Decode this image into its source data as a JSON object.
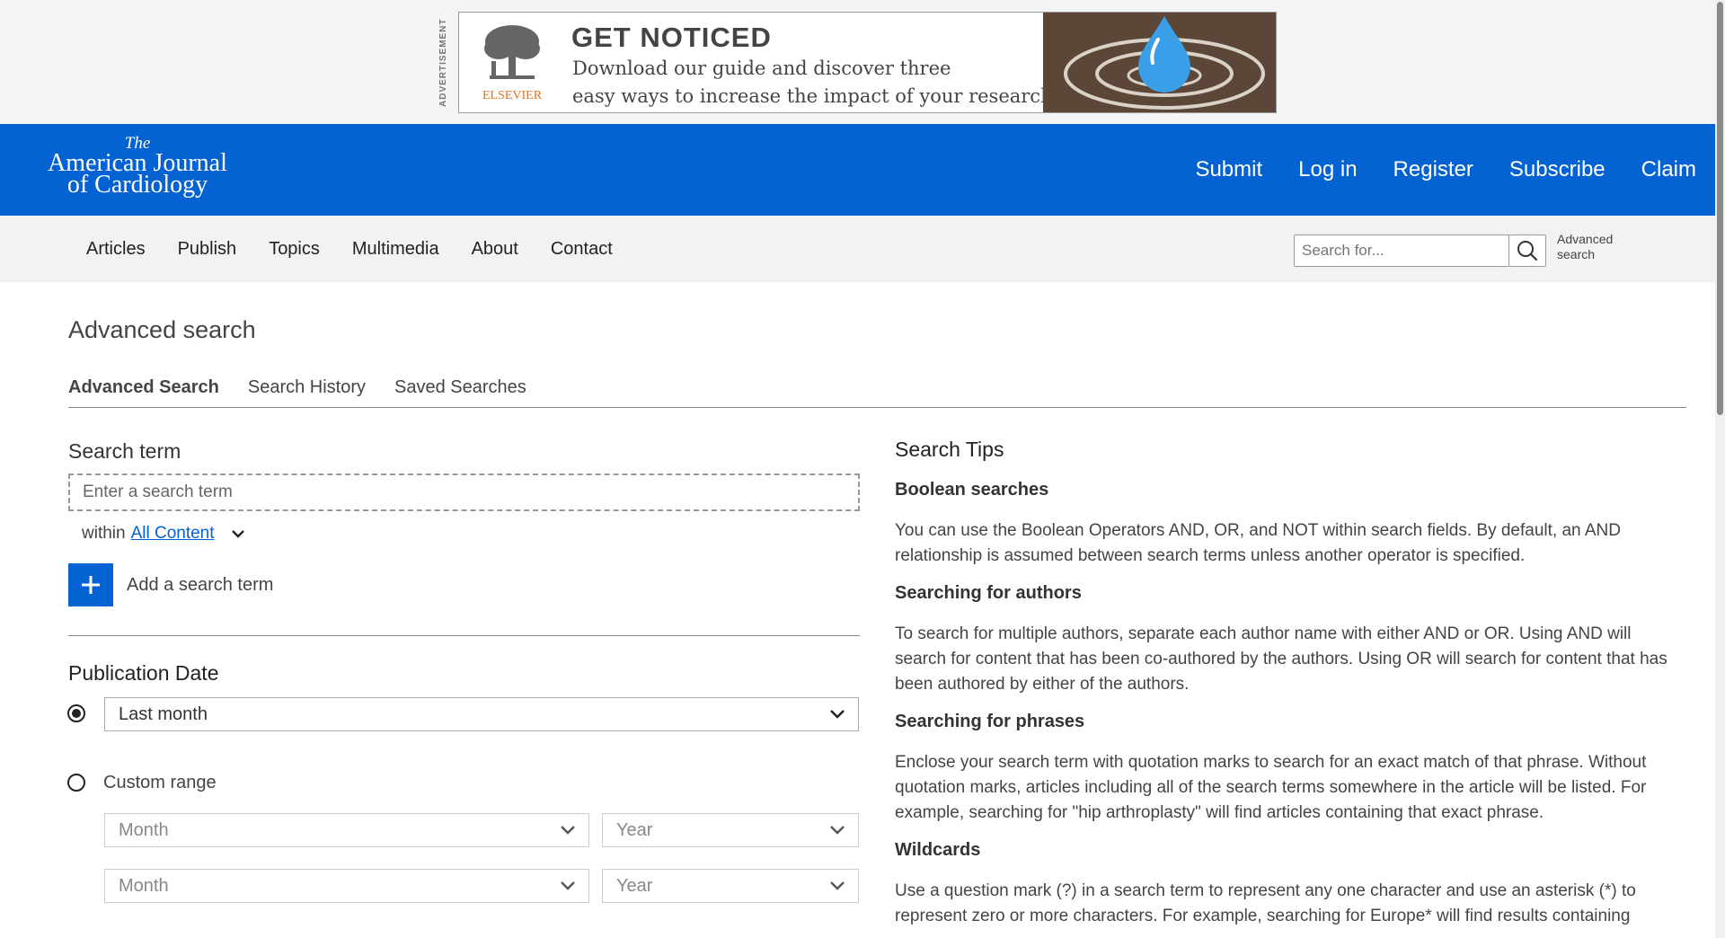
{
  "ad": {
    "label": "ADVERTISEMENT",
    "logo_text": "ELSEVIER",
    "headline": "GET NOTICED",
    "line1": "Download our guide and discover three",
    "line2": "easy ways to increase the impact of your research."
  },
  "header": {
    "logo": {
      "the": "The",
      "line1": "American Journal",
      "line2": "of Cardiology"
    },
    "nav": [
      "Submit",
      "Log in",
      "Register",
      "Subscribe",
      "Claim"
    ]
  },
  "subnav": {
    "items": [
      "Articles",
      "Publish",
      "Topics",
      "Multimedia",
      "About",
      "Contact"
    ],
    "search_placeholder": "Search for...",
    "advanced_search": "Advanced search"
  },
  "page": {
    "title": "Advanced search",
    "tabs": [
      {
        "label": "Advanced Search",
        "active": true
      },
      {
        "label": "Search History",
        "active": false
      },
      {
        "label": "Saved Searches",
        "active": false
      }
    ]
  },
  "search_form": {
    "search_term_heading": "Search term",
    "input_placeholder": "Enter a search term",
    "within_label": "within",
    "within_value": "All Content",
    "add_label": "Add a search term",
    "publication_date_heading": "Publication Date",
    "preset_selected": "Last month",
    "custom_range_label": "Custom range",
    "month_placeholder": "Month",
    "year_placeholder": "Year"
  },
  "tips": {
    "heading": "Search Tips",
    "sections": [
      {
        "title": "Boolean searches",
        "text": "You can use the Boolean Operators AND, OR, and NOT within search fields. By default, an AND relationship is assumed between search terms unless another operator is specified."
      },
      {
        "title": "Searching for authors",
        "text": "To search for multiple authors, separate each author name with either AND or OR. Using AND will search for content that has been co-authored by the authors. Using OR will search for content that has been authored by either of the authors."
      },
      {
        "title": "Searching for phrases",
        "text": "Enclose your search term with quotation marks to search for an exact match of that phrase. Without quotation marks, articles including all of the search terms somewhere in the article will be listed. For example, searching for \"hip arthroplasty\" will find articles containing that exact phrase."
      },
      {
        "title": "Wildcards",
        "text": "Use a question mark (?) in a search term to represent any one character and use an asterisk (*) to represent zero or more characters. For example, searching for Europe* will find results containing"
      }
    ]
  },
  "colors": {
    "brand_blue": "#0562d2",
    "subnav_bg": "#f2f2f2",
    "ad_accent": "#e9711c"
  },
  "icons": [
    "tree-logo-icon",
    "water-drop-icon",
    "search-icon",
    "chevron-down-icon",
    "plus-icon"
  ]
}
